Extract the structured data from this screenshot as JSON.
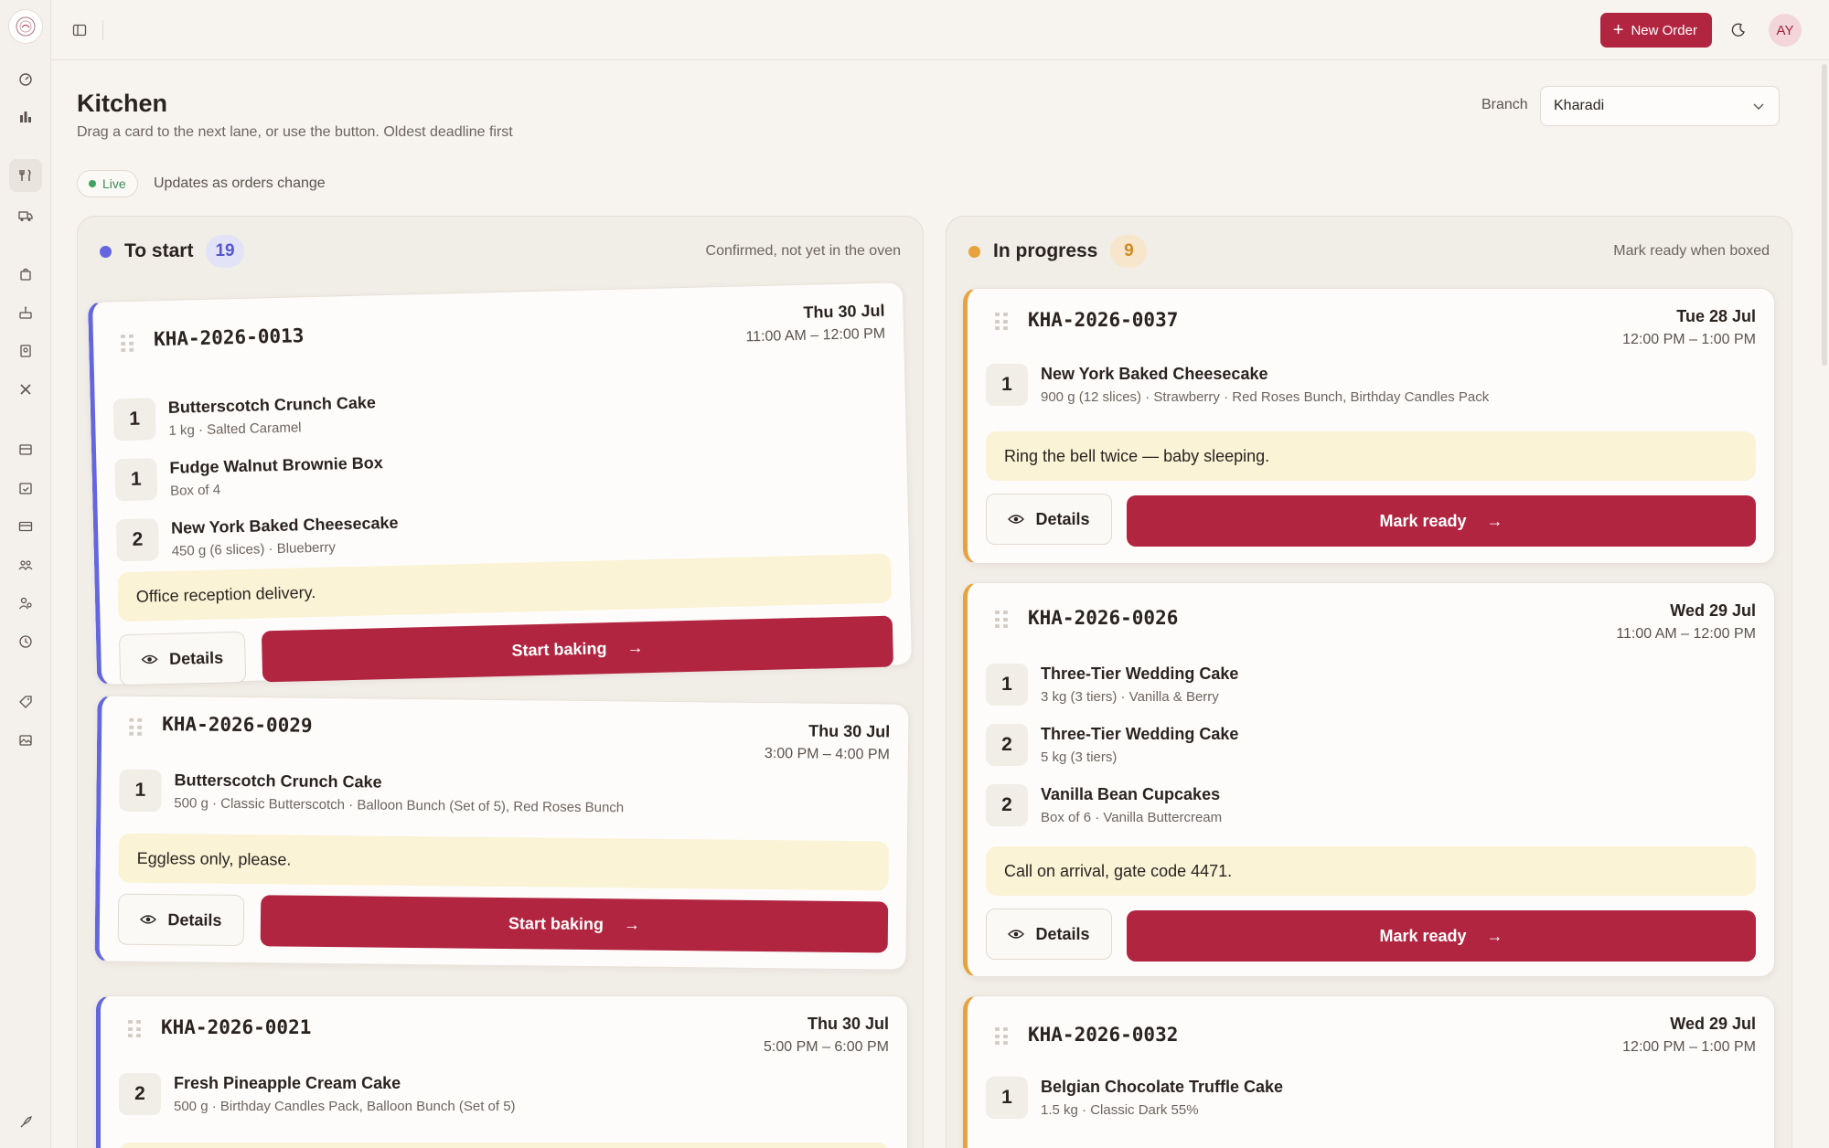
{
  "topbar": {
    "new_order_label": "New Order",
    "avatar_initials": "AY"
  },
  "page": {
    "title": "Kitchen",
    "subtitle": "Drag a card to the next lane, or use the button. Oldest deadline first",
    "branch_label": "Branch",
    "branch_value": "Kharadi",
    "live_label": "Live",
    "live_text": "Updates as orders change"
  },
  "colors": {
    "accent": "#b22540",
    "to_start": "#6366e0",
    "in_progress": "#e9a23b",
    "note_bg": "#fbf3d6"
  },
  "lanes": {
    "to_start": {
      "title": "To start",
      "count": "19",
      "hint": "Confirmed, not yet in the oven",
      "action_label": "Start baking",
      "cards": [
        {
          "id": "KHA-2026-0013",
          "due_date": "Thu 30 Jul",
          "due_time": "11:00 AM – 12:00 PM",
          "items": [
            {
              "qty": "1",
              "name": "Butterscotch Crunch Cake",
              "meta": "1 kg · Salted Caramel"
            },
            {
              "qty": "1",
              "name": "Fudge Walnut Brownie Box",
              "meta": "Box of 4"
            },
            {
              "qty": "2",
              "name": "New York Baked Cheesecake",
              "meta": "450 g (6 slices) · Blueberry"
            }
          ],
          "note": "Office reception delivery."
        },
        {
          "id": "KHA-2026-0029",
          "due_date": "Thu 30 Jul",
          "due_time": "3:00 PM – 4:00 PM",
          "items": [
            {
              "qty": "1",
              "name": "Butterscotch Crunch Cake",
              "meta": "500 g · Classic Butterscotch · Balloon Bunch (Set of 5), Red Roses Bunch"
            }
          ],
          "note": "Eggless only, please."
        },
        {
          "id": "KHA-2026-0021",
          "due_date": "Thu 30 Jul",
          "due_time": "5:00 PM – 6:00 PM",
          "items": [
            {
              "qty": "2",
              "name": "Fresh Pineapple Cream Cake",
              "meta": "500 g · Birthday Candles Pack, Balloon Bunch (Set of 5)"
            }
          ]
        }
      ]
    },
    "in_progress": {
      "title": "In progress",
      "count": "9",
      "hint": "Mark ready when boxed",
      "action_label": "Mark ready",
      "cards": [
        {
          "id": "KHA-2026-0037",
          "due_date": "Tue 28 Jul",
          "due_time": "12:00 PM – 1:00 PM",
          "items": [
            {
              "qty": "1",
              "name": "New York Baked Cheesecake",
              "meta": "900 g (12 slices) · Strawberry · Red Roses Bunch, Birthday Candles Pack"
            }
          ],
          "note": "Ring the bell twice — baby sleeping."
        },
        {
          "id": "KHA-2026-0026",
          "due_date": "Wed 29 Jul",
          "due_time": "11:00 AM – 12:00 PM",
          "items": [
            {
              "qty": "1",
              "name": "Three-Tier Wedding Cake",
              "meta": "3 kg (3 tiers) · Vanilla & Berry"
            },
            {
              "qty": "2",
              "name": "Three-Tier Wedding Cake",
              "meta": "5 kg (3 tiers)"
            },
            {
              "qty": "2",
              "name": "Vanilla Bean Cupcakes",
              "meta": "Box of 6 · Vanilla Buttercream"
            }
          ],
          "note": "Call on arrival, gate code 4471."
        },
        {
          "id": "KHA-2026-0032",
          "due_date": "Wed 29 Jul",
          "due_time": "12:00 PM – 1:00 PM",
          "items": [
            {
              "qty": "1",
              "name": "Belgian Chocolate Truffle Cake",
              "meta": "1.5 kg · Classic Dark 55%"
            }
          ]
        }
      ]
    }
  },
  "buttons": {
    "details_label": "Details"
  }
}
